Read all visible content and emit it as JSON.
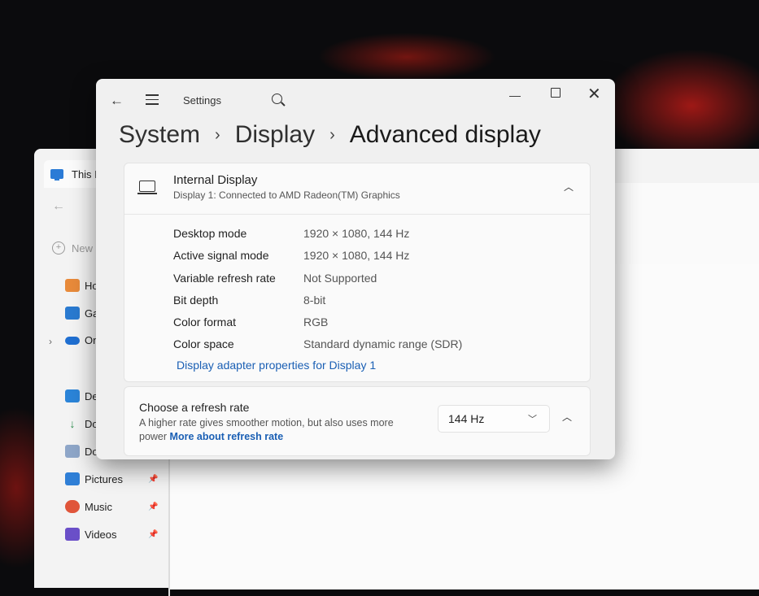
{
  "explorer": {
    "tab_label": "This I",
    "new_label": "New",
    "nav": [
      {
        "label": "Ho",
        "icon": "home-icon"
      },
      {
        "label": "Gal",
        "icon": "gallery-icon"
      },
      {
        "label": "One",
        "icon": "onedrive-icon"
      },
      {
        "label": "Des",
        "icon": "desktop-folder-icon"
      },
      {
        "label": "Dov",
        "icon": "downloads-icon"
      },
      {
        "label": "Doc",
        "icon": "documents-icon"
      },
      {
        "label": "Pictures",
        "icon": "pictures-icon"
      },
      {
        "label": "Music",
        "icon": "music-icon"
      },
      {
        "label": "Videos",
        "icon": "videos-icon"
      }
    ]
  },
  "settings": {
    "window_title": "Settings",
    "breadcrumb": {
      "root": "System",
      "mid": "Display",
      "current": "Advanced display"
    },
    "display_panel": {
      "title": "Internal Display",
      "subtitle": "Display 1: Connected to AMD Radeon(TM) Graphics",
      "rows": [
        {
          "label": "Desktop mode",
          "value": "1920 × 1080, 144 Hz"
        },
        {
          "label": "Active signal mode",
          "value": "1920 × 1080, 144 Hz"
        },
        {
          "label": "Variable refresh rate",
          "value": "Not Supported"
        },
        {
          "label": "Bit depth",
          "value": "8-bit"
        },
        {
          "label": "Color format",
          "value": "RGB"
        },
        {
          "label": "Color space",
          "value": "Standard dynamic range (SDR)"
        }
      ],
      "adapter_link": "Display adapter properties for Display 1"
    },
    "refresh": {
      "title": "Choose a refresh rate",
      "description": "A higher rate gives smoother motion, but also uses more power",
      "link": "More about refresh rate",
      "selected": "144 Hz"
    }
  },
  "colors": {
    "link": "#1a5fb4",
    "window_bg": "#f0f0f0",
    "card_bg": "#fafafa"
  }
}
